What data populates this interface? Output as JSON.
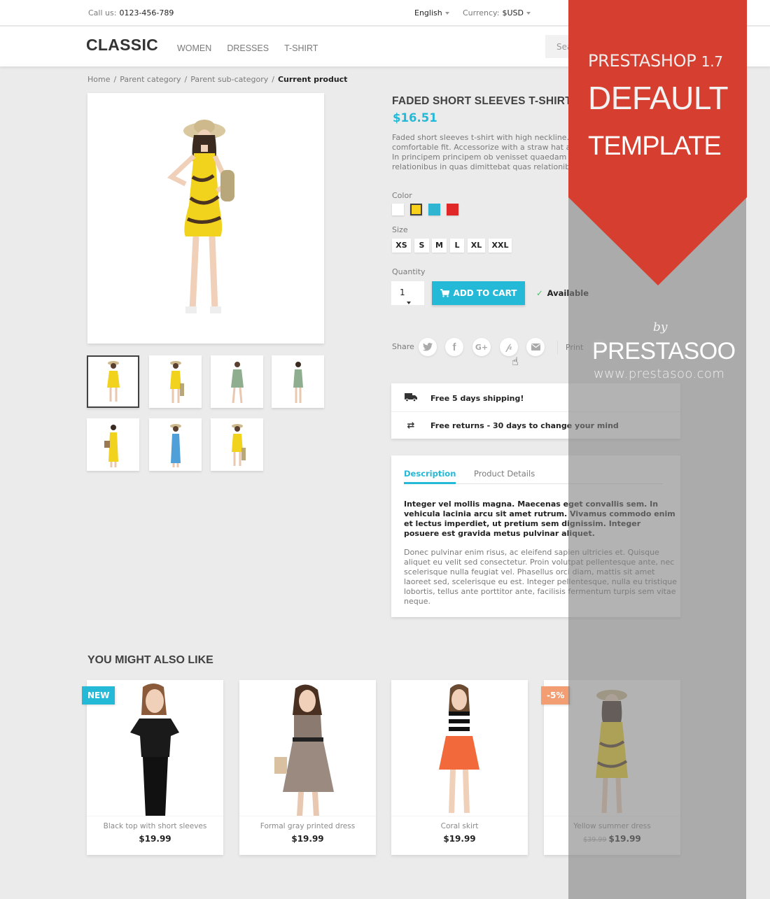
{
  "topbar": {
    "call_label": "Call us:",
    "phone": "0123-456-789",
    "language": "English",
    "currency_label": "Currency:",
    "currency": "$USD"
  },
  "header": {
    "logo": "CLASSIC",
    "nav": [
      "WOMEN",
      "DRESSES",
      "T-SHIRT"
    ],
    "search_placeholder": "Search"
  },
  "breadcrumb": [
    "Home",
    "Parent category",
    "Parent sub-category",
    "Current product"
  ],
  "breadcrumb_separator": "/",
  "product": {
    "title": "FADED SHORT SLEEVES T-SHIRT",
    "price": "$16.51",
    "description_lines": [
      "Faded short sleeves t-shirt with high neckline. Soft and stretchy material for a",
      "comfortable fit. Accessorize with a straw hat and you're ready for summer!",
      "In principem principem ob venisset quaedam ventum",
      "relationibus in quas dimittebat quas relationibus"
    ],
    "color_label": "Color",
    "colors": [
      {
        "name": "White",
        "hex": "#ffffff",
        "selected": false
      },
      {
        "name": "Yellow",
        "hex": "#f9d01c",
        "selected": true
      },
      {
        "name": "Blue",
        "hex": "#2fb5d2",
        "selected": false
      },
      {
        "name": "Red",
        "hex": "#e02828",
        "selected": false
      }
    ],
    "size_label": "Size",
    "sizes": [
      "XS",
      "S",
      "M",
      "L",
      "XL",
      "XXL"
    ],
    "quantity_label": "Quantity",
    "quantity": "1",
    "add_to_cart": "ADD TO CART",
    "availability": "Available",
    "share_label": "Share",
    "share_icons": [
      "twitter-icon",
      "facebook-icon",
      "google-plus-icon",
      "pinterest-icon",
      "email-icon"
    ],
    "print_label": "Print",
    "thumbnail_count": 7
  },
  "reassurance": [
    {
      "icon": "truck-icon",
      "text": "Free 5 days shipping!"
    },
    {
      "icon": "returns-icon",
      "text": "Free returns - 30 days to change your mind"
    }
  ],
  "tabs": {
    "items": [
      "Description",
      "Product Details"
    ],
    "active": "Description",
    "description_bold": "Integer vel mollis magna. Maecenas eget convallis sem. In vehicula lacinia arcu sit amet rutrum. Vivamus commodo enim et lectus imperdiet, ut pretium sem dignissim. Integer posuere est gravida metus pulvinar aliquet.",
    "description": "Donec pulvinar enim risus, ac eleifend sapien ultricies et. Quisque aliquet eu velit sed consectetur. Proin volutpat pellentesque ante, nec scelerisque nulla feugiat vel. Phasellus orci diam, mattis sit amet laoreet sed, scelerisque eu est. Integer pellentesque, nulla eu tristique lobortis, tellus ante porttitor ante, facilisis fermentum turpis sem vitae neque."
  },
  "related": {
    "title": "YOU MIGHT ALSO LIKE",
    "products": [
      {
        "name": "Black top with short sleeves",
        "price": "$19.99",
        "old_price": null,
        "flag": "NEW"
      },
      {
        "name": "Formal gray printed dress",
        "price": "$19.99",
        "old_price": null,
        "flag": null
      },
      {
        "name": "Coral skirt",
        "price": "$19.99",
        "old_price": null,
        "flag": null
      },
      {
        "name": "Yellow summer dress",
        "price": "$19.99",
        "old_price": "$39.99",
        "flag": "-5%"
      }
    ]
  },
  "promo": {
    "line1": "PRESTASHOP",
    "version": "1.7",
    "line2": "DEFAULT",
    "line3": "TEMPLATE",
    "by": "by",
    "brand": "PRESTASOO",
    "url": "www.prestasoo.com"
  },
  "colors": {
    "accent": "#24b9d7",
    "banner_red": "#d63e2f",
    "flag_new": "#24b9d7",
    "flag_discount": "#f39d72",
    "background": "#ebebeb"
  }
}
